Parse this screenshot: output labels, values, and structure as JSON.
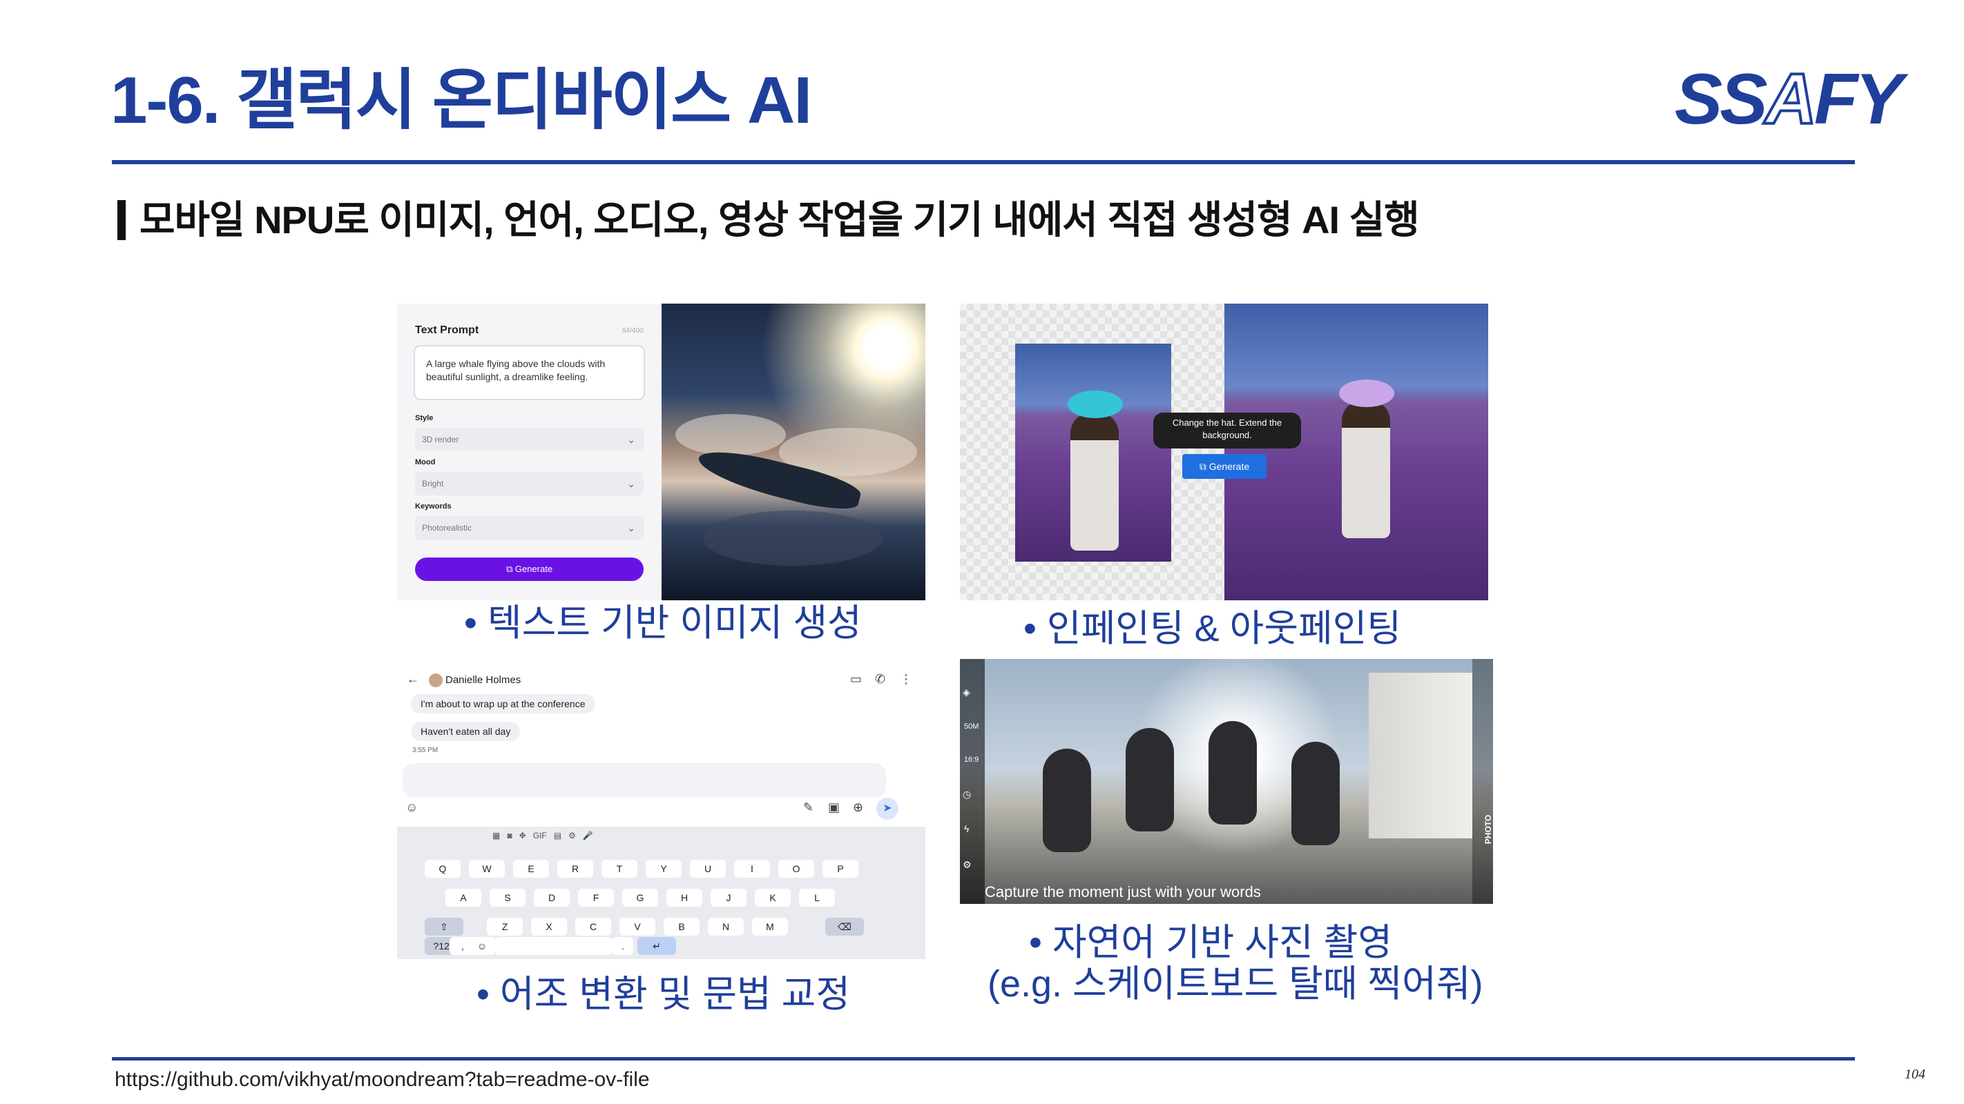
{
  "header": {
    "title": "1-6. 갤럭시 온디바이스 AI",
    "logo": "SSAFY",
    "subtitle": "모바일 NPU로 이미지, 언어, 오디오, 영상 작업을 기기 내에서 직접 생성형 AI 실행"
  },
  "panels": {
    "text_to_image": {
      "caption": "• 텍스트 기반 이미지 생성",
      "ui": {
        "heading": "Text Prompt",
        "counter": "84/400",
        "prompt_text": "A large whale flying above the clouds with beautiful sunlight, a dreamlike feeling.",
        "style_label": "Style",
        "style_value": "3D render",
        "mood_label": "Mood",
        "mood_value": "Bright",
        "keywords_label": "Keywords",
        "keywords_value": "Photorealistic",
        "generate_label": "Generate"
      }
    },
    "inpainting": {
      "caption": "• 인페인팅 & 아웃페인팅",
      "bubble_text": "Change the hat. Extend the background.",
      "generate_label": "Generate"
    },
    "tone": {
      "caption": "• 어조 변환 및 문법 교정",
      "contact_name": "Danielle Holmes",
      "messages": [
        "I'm about to wrap up at the conference",
        "Haven't eaten all day"
      ],
      "timestamp": "3:55 PM",
      "keyboard_rows": [
        [
          "Q",
          "W",
          "E",
          "R",
          "T",
          "Y",
          "U",
          "I",
          "O",
          "P"
        ],
        [
          "A",
          "S",
          "D",
          "F",
          "G",
          "H",
          "J",
          "K",
          "L"
        ],
        [
          "Z",
          "X",
          "C",
          "V",
          "B",
          "N",
          "M"
        ]
      ],
      "sym_key": "?123",
      "comma_key": ",",
      "period_key": ".",
      "gif_label": "GIF"
    },
    "photo": {
      "caption_line1": "• 자연어 기반 사진 촬영",
      "caption_line2": "(e.g. 스케이트보드 탈때 찍어줘)",
      "overlay_text": "Capture the moment just with your words",
      "side_labels": [
        "50M",
        "16:9"
      ],
      "mode_label": "PHOTO"
    }
  },
  "footer": {
    "url": "https://github.com/vikhyat/moondream?tab=readme-ov-file",
    "page": "104"
  },
  "colors": {
    "primary": "#1f3f9b",
    "generate_purple": "#6a12e6",
    "generate_blue": "#1f6fe0"
  }
}
